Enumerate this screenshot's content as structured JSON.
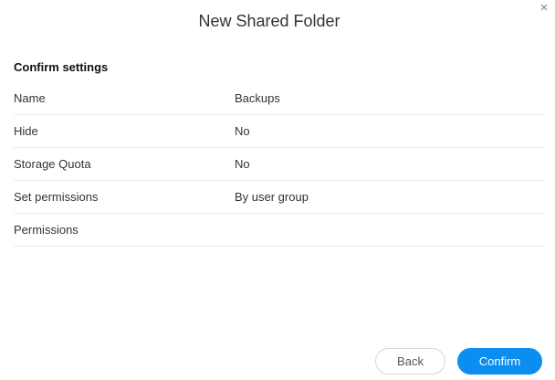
{
  "dialog": {
    "title": "New Shared Folder",
    "close_icon": "close-icon"
  },
  "section": {
    "title": "Confirm settings"
  },
  "settings": [
    {
      "label": "Name",
      "value": "Backups"
    },
    {
      "label": "Hide",
      "value": "No"
    },
    {
      "label": "Storage Quota",
      "value": "No"
    },
    {
      "label": "Set permissions",
      "value": "By user group"
    },
    {
      "label": "Permissions",
      "value": ""
    }
  ],
  "buttons": {
    "back_label": "Back",
    "confirm_label": "Confirm"
  },
  "colors": {
    "accent": "#0b8ef0",
    "divider": "#eaeaea",
    "text": "#333333"
  }
}
